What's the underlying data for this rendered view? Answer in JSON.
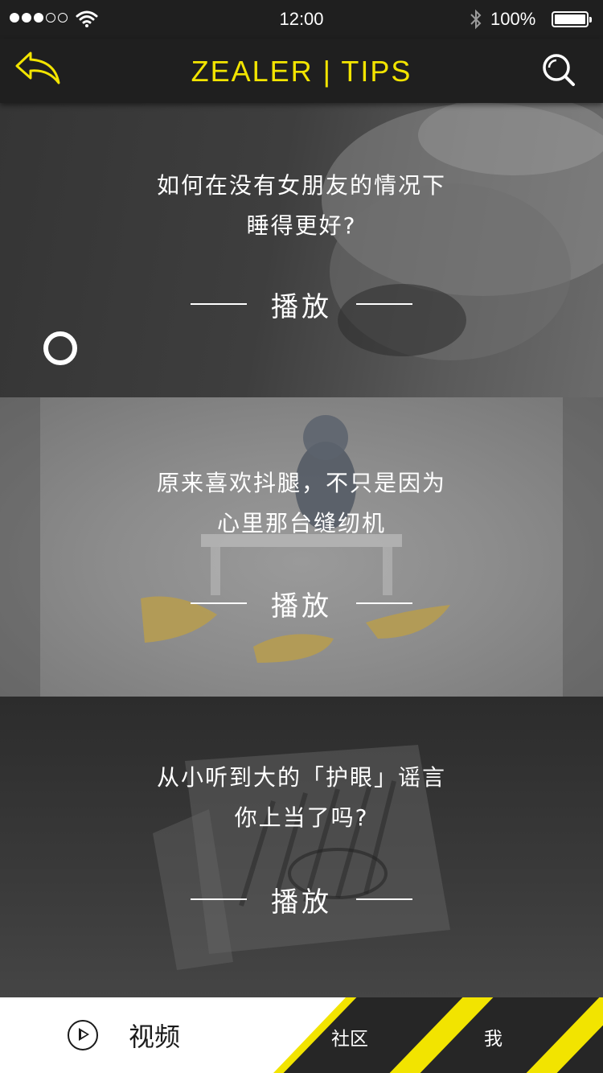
{
  "status_bar": {
    "time": "12:00",
    "battery": "100%",
    "signal_bars_filled": 3,
    "signal_bars_total": 5,
    "icons": [
      "signal-icon",
      "wifi-icon",
      "bluetooth-icon",
      "battery-icon"
    ]
  },
  "nav": {
    "title": "ZEALER | TIPS",
    "accent_color": "#f2e400",
    "back_icon": "back-arrow-icon",
    "search_icon": "search-icon"
  },
  "cards": [
    {
      "line1": "如何在没有女朋友的情况下",
      "line2": "睡得更好?",
      "play_label": "播放"
    },
    {
      "line1": "原来喜欢抖腿，不只是因为",
      "line2": "心里那台缝纫机",
      "play_label": "播放"
    },
    {
      "line1": "从小听到大的「护眼」谣言",
      "line2": "你上当了吗?",
      "play_label": "播放"
    }
  ],
  "tabbar": {
    "video_label": "视频",
    "community_label": "社区",
    "me_label": "我",
    "active_tab": "视频",
    "stripe_color": "#f2e400"
  }
}
